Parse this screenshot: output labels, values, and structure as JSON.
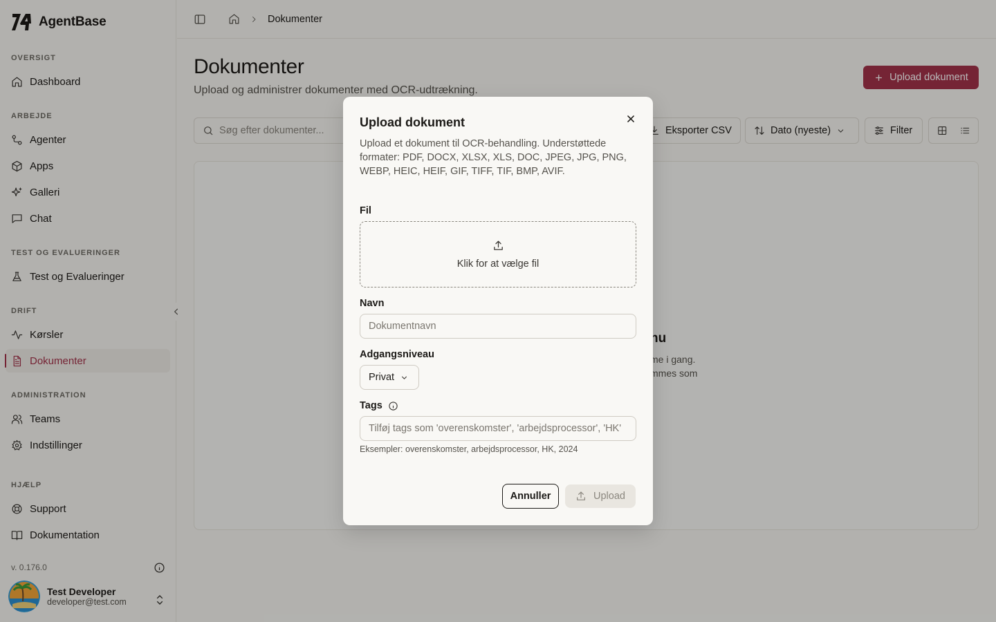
{
  "brand": {
    "name": "AgentBase"
  },
  "sidebar": {
    "sections": [
      {
        "title": "OVERSIGT",
        "items": [
          {
            "label": "Dashboard",
            "icon": "home-icon"
          }
        ]
      },
      {
        "title": "ARBEJDE",
        "items": [
          {
            "label": "Agenter",
            "icon": "workflow-icon"
          },
          {
            "label": "Apps",
            "icon": "box-icon"
          },
          {
            "label": "Galleri",
            "icon": "sparkles-icon"
          },
          {
            "label": "Chat",
            "icon": "message-square-icon"
          }
        ]
      },
      {
        "title": "TEST OG EVALUERINGER",
        "items": [
          {
            "label": "Test og Evalueringer",
            "icon": "flask-icon"
          }
        ]
      },
      {
        "title": "DRIFT",
        "items": [
          {
            "label": "Kørsler",
            "icon": "activity-icon"
          },
          {
            "label": "Dokumenter",
            "icon": "file-text-icon",
            "active": true
          }
        ]
      },
      {
        "title": "ADMINISTRATION",
        "items": [
          {
            "label": "Teams",
            "icon": "users-icon"
          },
          {
            "label": "Indstillinger",
            "icon": "gear-icon"
          }
        ]
      },
      {
        "title": "HJÆLP",
        "items": [
          {
            "label": "Support",
            "icon": "life-buoy-icon"
          },
          {
            "label": "Dokumentation",
            "icon": "book-icon"
          }
        ]
      }
    ],
    "version": "v. 0.176.0",
    "user": {
      "name": "Test Developer",
      "email": "developer@test.com"
    }
  },
  "topbar": {
    "breadcrumb_current": "Dokumenter"
  },
  "page": {
    "title": "Dokumenter",
    "subtitle": "Upload og administrer dokumenter med OCR-udtrækning.",
    "upload_button": "Upload dokument",
    "search_placeholder": "Søg efter dokumenter...",
    "export_label": "Eksporter CSV",
    "sort_label": "Dato (nyeste)",
    "filter_label": "Filter",
    "empty_title_fragment": "nu",
    "empty_line1_fragment": "me i gang.",
    "empty_line2_fragment": "mmes som"
  },
  "modal": {
    "title": "Upload dokument",
    "description": "Upload et dokument til OCR-behandling. Understøttede formater: PDF, DOCX, XLSX, XLS, DOC, JPEG, JPG, PNG, WEBP, HEIC, HEIF, GIF, TIFF, TIF, BMP, AVIF.",
    "file_label": "Fil",
    "dropzone_text": "Klik for at vælge fil",
    "name_label": "Navn",
    "name_placeholder": "Dokumentnavn",
    "access_label": "Adgangsniveau",
    "access_value": "Privat",
    "tags_label": "Tags",
    "tags_placeholder": "Tilføj tags som 'overenskomster', 'arbejdsprocessor', 'HK'",
    "tags_hint": "Eksempler: overenskomster, arbejdsprocessor, HK, 2024",
    "cancel_label": "Annuller",
    "upload_label": "Upload"
  },
  "colors": {
    "accent": "#a3324a",
    "background": "#f7f6f2"
  }
}
